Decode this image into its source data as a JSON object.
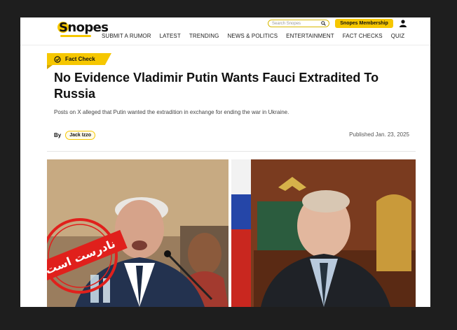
{
  "header": {
    "logo_text": "Snopes",
    "search_placeholder": "Search Snopes",
    "membership_label": "Snopes Membership",
    "nav": [
      "SUBMIT A RUMOR",
      "LATEST",
      "TRENDING",
      "NEWS & POLITICS",
      "ENTERTAINMENT",
      "FACT CHECKS",
      "QUIZ"
    ]
  },
  "article": {
    "badge": "Fact Check",
    "title": "No Evidence Vladimir Putin Wants Fauci Extradited To Russia",
    "subtitle": "Posts on X alleged that Putin wanted the extradition in exchange for ending the war in Ukraine.",
    "by_label": "By",
    "author": "Jack Izzo",
    "published": "Published Jan. 23, 2025"
  },
  "image": {
    "stamp_text": "نادرست است"
  },
  "colors": {
    "brand_yellow": "#f6c700",
    "stamp_red": "#e0201c"
  }
}
